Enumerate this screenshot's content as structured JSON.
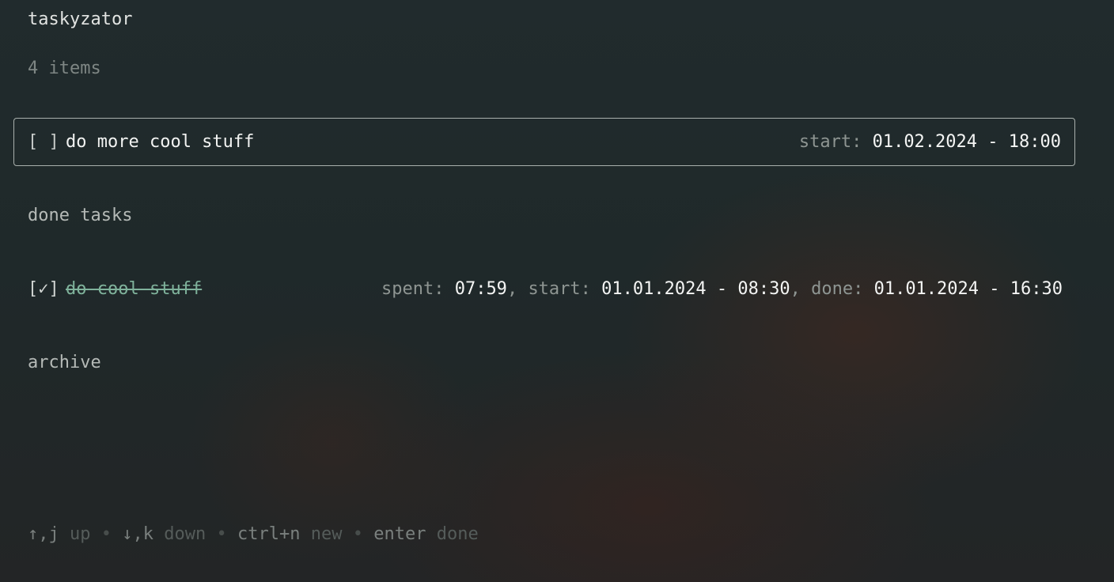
{
  "app": {
    "title": "taskyzator",
    "item_count": "4 items"
  },
  "active_task": {
    "checkbox": "[ ]",
    "name": "do more cool stuff",
    "start_label": "start:",
    "start_value": "01.02.2024 - 18:00"
  },
  "sections": {
    "done": "done tasks",
    "archive": "archive"
  },
  "done_tasks": [
    {
      "checkbox": "[✓]",
      "name": "do cool stuff",
      "spent_label": "spent:",
      "spent_value": "07:59",
      "start_label": "start:",
      "start_value": "01.01.2024 - 08:30",
      "done_label": "done:",
      "done_value": "01.01.2024 - 16:30",
      "separator": ","
    }
  ],
  "help": {
    "up_key": "↑,j",
    "up_desc": "up",
    "down_key": "↓,k",
    "down_desc": "down",
    "new_key": "ctrl+n",
    "new_desc": "new",
    "done_key": "enter",
    "done_desc": "done",
    "bullet": "•"
  }
}
